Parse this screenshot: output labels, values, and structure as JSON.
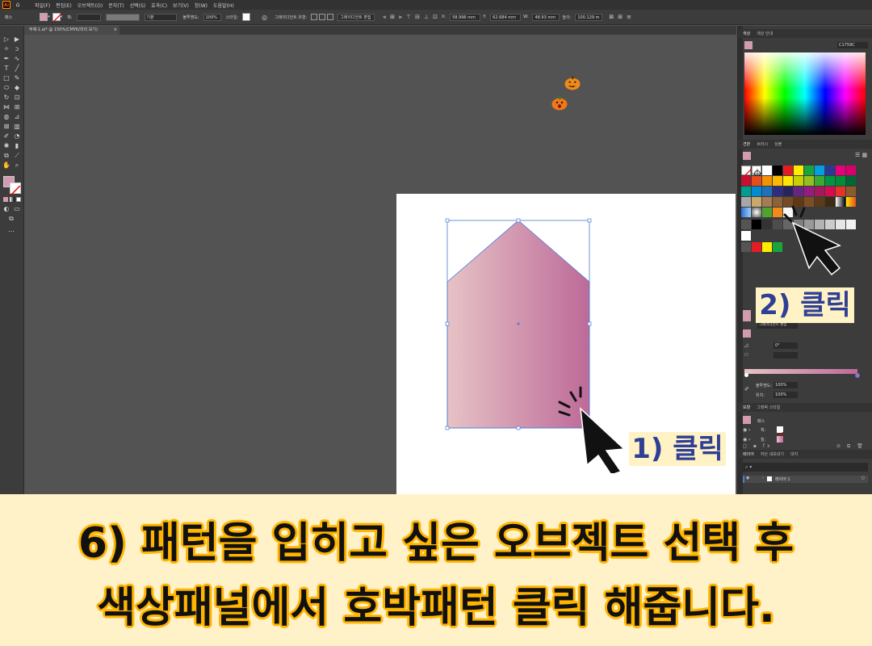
{
  "menubar": {
    "items": [
      "파일(F)",
      "편집(E)",
      "오브젝트(O)",
      "문자(T)",
      "선택(S)",
      "효과(C)",
      "보기(V)",
      "창(W)",
      "도움말(H)"
    ]
  },
  "controlbar": {
    "selection_label": "패스",
    "stroke_style": "기본",
    "opacity_label": "불투명도:",
    "opacity_value": "100%",
    "style_label": "스타일:",
    "gradient_tool_label": "그레이디언트 유형:",
    "gradient_edit_button": "그레이디언트 편집",
    "x_label": "X:",
    "x_value": "58.996 mm",
    "y_label": "Y:",
    "y_value": "62.684 mm",
    "w_label": "W:",
    "w_value": "48.93 mm",
    "h_label": "높이:",
    "h_value": "100.129 m"
  },
  "document": {
    "tab_title": "무제-1.ai* @ 150%(CMYK/미리 보기)",
    "close": "×"
  },
  "color_panel": {
    "tabs": [
      "색상",
      "색상 안내"
    ],
    "hex_value": "C1759C"
  },
  "swatches_panel": {
    "tabs": [
      "견본",
      "브러시",
      "심볼"
    ]
  },
  "gradient_panel": {
    "tooltip": "그레이디언트 편집",
    "angle_value": "0°",
    "opacity_label": "불투명도:",
    "opacity_value": "100%",
    "location_label": "위치:",
    "location_value": "100%"
  },
  "appearance_panel": {
    "tabs": [
      "모양",
      "그래픽 스타일"
    ],
    "path_label": "패스",
    "stroke_label": "획:",
    "fill_label": "칠:"
  },
  "layers_panel": {
    "tabs": [
      "레이어",
      "자산 내보내기",
      "대지"
    ],
    "layer_name": "레이어 1"
  },
  "annotations": {
    "step1": "1) 클릭",
    "step2": "2) 클릭"
  },
  "caption": {
    "line1": "6) 패턴을 입히고 싶은 오브젝트 선택 후",
    "line2": "색상패널에서 호박패턴 클릭 해줍니다."
  },
  "colors": {
    "gradient_start": "#e8c4c9",
    "gradient_end": "#bd6a98",
    "selection_blue": "#4a7bd6",
    "label_text": "#2e3f95",
    "label_bg": "#fff2c4",
    "caption_bg": "#fff1c8",
    "caption_outline": "#ffb400"
  }
}
